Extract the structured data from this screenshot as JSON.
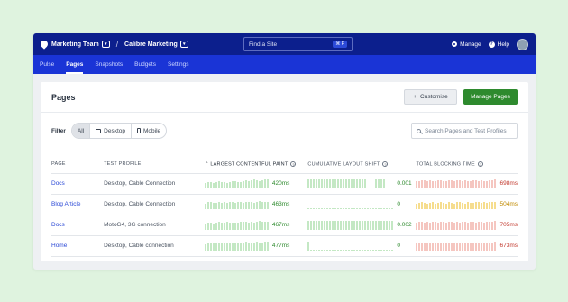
{
  "topbar": {
    "team": "Marketing Team",
    "project": "Calibre Marketing",
    "search_placeholder": "Find a Site",
    "search_shortcut": "⌘ P",
    "manage": "Manage",
    "help": "Help",
    "help_glyph": "?"
  },
  "nav": {
    "tabs": [
      "Pulse",
      "Pages",
      "Snapshots",
      "Budgets",
      "Settings"
    ],
    "active": "Pages"
  },
  "pages_card": {
    "title": "Pages",
    "customise_label": "Customise",
    "manage_label": "Manage Pages",
    "filter_label": "Filter",
    "filters": [
      "All",
      "Desktop",
      "Mobile"
    ],
    "active_filter": "All",
    "search_placeholder": "Search Pages and Test Profiles"
  },
  "table": {
    "columns": [
      "PAGE",
      "TEST PROFILE",
      "LARGEST CONTENTFUL PAINT",
      "CUMULATIVE LAYOUT SHIFT",
      "TOTAL BLOCKING TIME"
    ],
    "sorted_column": "LARGEST CONTENTFUL PAINT",
    "rows": [
      {
        "page": "Docs",
        "profile": "Desktop, Cable Connection",
        "lcp": "420ms",
        "cls": "0.001",
        "tbt": "698ms",
        "tbt_status": "bad",
        "lcp_bars": [
          6,
          7,
          7,
          6,
          7,
          8,
          7,
          7,
          6,
          7,
          8,
          8,
          7,
          7,
          8,
          9,
          8,
          9,
          10,
          9,
          8,
          9,
          10,
          10
        ],
        "cls_bars": [
          10,
          10,
          10,
          10,
          10,
          10,
          10,
          10,
          10,
          10,
          10,
          10,
          10,
          10,
          10,
          10,
          10,
          10,
          10,
          10,
          10,
          10,
          1,
          1,
          1,
          10,
          10,
          10,
          10,
          1,
          1,
          1
        ],
        "tbt_bars": [
          8,
          8,
          9,
          9,
          8,
          9,
          8,
          8,
          9,
          9,
          8,
          8,
          9,
          9,
          8,
          9,
          9,
          8,
          9,
          8,
          8,
          9,
          9,
          8,
          9,
          8,
          8,
          9,
          9,
          10
        ]
      },
      {
        "page": "Blog Article",
        "profile": "Desktop, Cable Connection",
        "lcp": "463ms",
        "cls": "0",
        "tbt": "504ms",
        "tbt_status": "warn",
        "lcp_bars": [
          6,
          8,
          8,
          7,
          7,
          8,
          7,
          8,
          7,
          8,
          8,
          7,
          8,
          8,
          7,
          8,
          8,
          8,
          7,
          8,
          9,
          8,
          8,
          8
        ],
        "cls_bars": [
          1,
          1,
          1,
          1,
          1,
          1,
          1,
          1,
          1,
          1,
          1,
          1,
          1,
          1,
          1,
          1,
          1,
          1,
          1,
          1,
          1,
          1,
          1,
          1,
          1,
          1,
          1,
          1,
          1,
          1,
          1,
          1
        ],
        "tbt_bars": [
          6,
          7,
          8,
          7,
          6,
          7,
          8,
          6,
          7,
          8,
          7,
          6,
          8,
          7,
          6,
          8,
          8,
          7,
          6,
          8,
          7,
          7,
          8,
          8,
          7,
          8,
          7,
          8,
          8,
          8
        ]
      },
      {
        "page": "Docs",
        "profile": "MotoG4, 3G connection",
        "lcp": "467ms",
        "cls": "0.002",
        "tbt": "705ms",
        "tbt_status": "bad",
        "lcp_bars": [
          7,
          8,
          8,
          7,
          8,
          9,
          8,
          8,
          9,
          8,
          8,
          8,
          8,
          9,
          9,
          9,
          8,
          9,
          8,
          9,
          10,
          9,
          9,
          9
        ],
        "cls_bars": [
          10,
          10,
          10,
          10,
          10,
          10,
          10,
          10,
          10,
          10,
          10,
          10,
          10,
          10,
          10,
          10,
          10,
          10,
          10,
          10,
          10,
          10,
          10,
          10,
          10,
          10,
          10,
          10,
          10,
          10,
          10,
          10
        ],
        "tbt_bars": [
          8,
          9,
          9,
          8,
          9,
          8,
          9,
          9,
          8,
          9,
          9,
          8,
          9,
          9,
          8,
          9,
          8,
          9,
          9,
          8,
          9,
          9,
          8,
          9,
          9,
          8,
          9,
          9,
          9,
          10
        ]
      },
      {
        "page": "Home",
        "profile": "Desktop, Cable connection",
        "lcp": "477ms",
        "cls": "0",
        "tbt": "673ms",
        "tbt_status": "bad",
        "lcp_bars": [
          7,
          8,
          8,
          8,
          9,
          8,
          9,
          9,
          8,
          9,
          9,
          9,
          9,
          9,
          9,
          10,
          9,
          9,
          9,
          10,
          9,
          9,
          10,
          10
        ],
        "cls_bars": [
          10,
          1,
          1,
          1,
          1,
          1,
          1,
          1,
          1,
          1,
          1,
          1,
          1,
          1,
          1,
          1,
          1,
          1,
          1,
          1,
          1,
          1,
          1,
          1,
          1,
          1,
          1,
          1,
          1,
          1,
          1,
          1
        ],
        "tbt_bars": [
          8,
          8,
          9,
          9,
          8,
          9,
          9,
          8,
          9,
          9,
          9,
          8,
          9,
          9,
          8,
          9,
          9,
          9,
          8,
          9,
          9,
          8,
          9,
          9,
          9,
          8,
          9,
          9,
          9,
          10
        ]
      }
    ]
  }
}
